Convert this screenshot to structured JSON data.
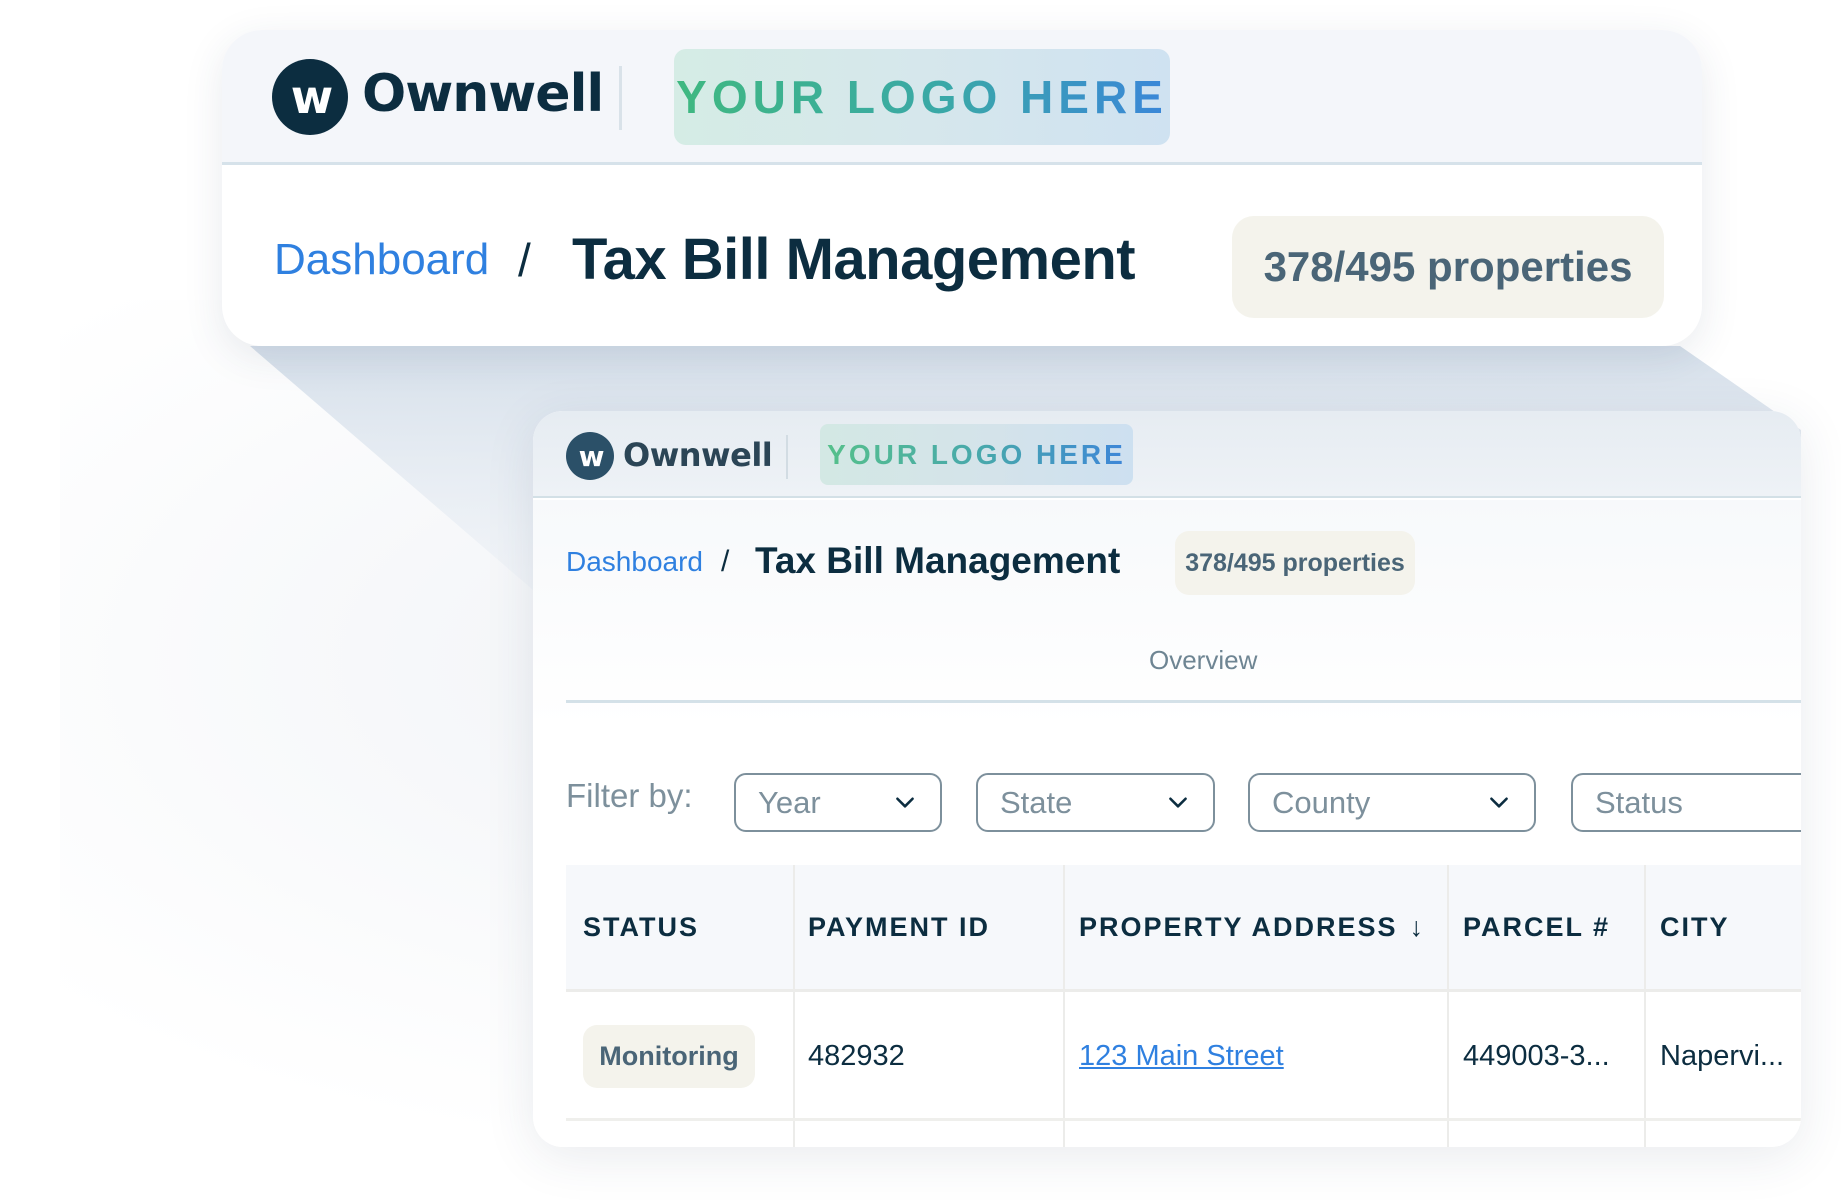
{
  "brand": {
    "name": "Ownwell",
    "mark": "w",
    "partner_logo_placeholder": "YOUR LOGO HERE"
  },
  "breadcrumb": {
    "parent": "Dashboard",
    "separator": "/",
    "current": "Tax Bill Management"
  },
  "properties_badge": "378/495 properties",
  "tabs": [
    {
      "label": "Overview",
      "active": true
    }
  ],
  "filters": {
    "label": "Filter by:",
    "selects": [
      {
        "placeholder": "Year"
      },
      {
        "placeholder": "State"
      },
      {
        "placeholder": "County"
      },
      {
        "placeholder": "Status"
      }
    ]
  },
  "table": {
    "columns": [
      {
        "label": "STATUS"
      },
      {
        "label": "PAYMENT ID"
      },
      {
        "label": "PROPERTY ADDRESS",
        "sort": "desc",
        "sort_icon": "↓"
      },
      {
        "label": "PARCEL #"
      },
      {
        "label": "CITY"
      }
    ],
    "rows": [
      {
        "status": "Monitoring",
        "payment_id": "482932",
        "property_address": "123 Main Street",
        "parcel": "449003-3...",
        "city": "Napervi..."
      }
    ]
  },
  "colors": {
    "navy": "#0c2d40",
    "link_blue": "#2f80e0",
    "badge_bg": "#f4f3ec",
    "muted": "#7d909c"
  }
}
